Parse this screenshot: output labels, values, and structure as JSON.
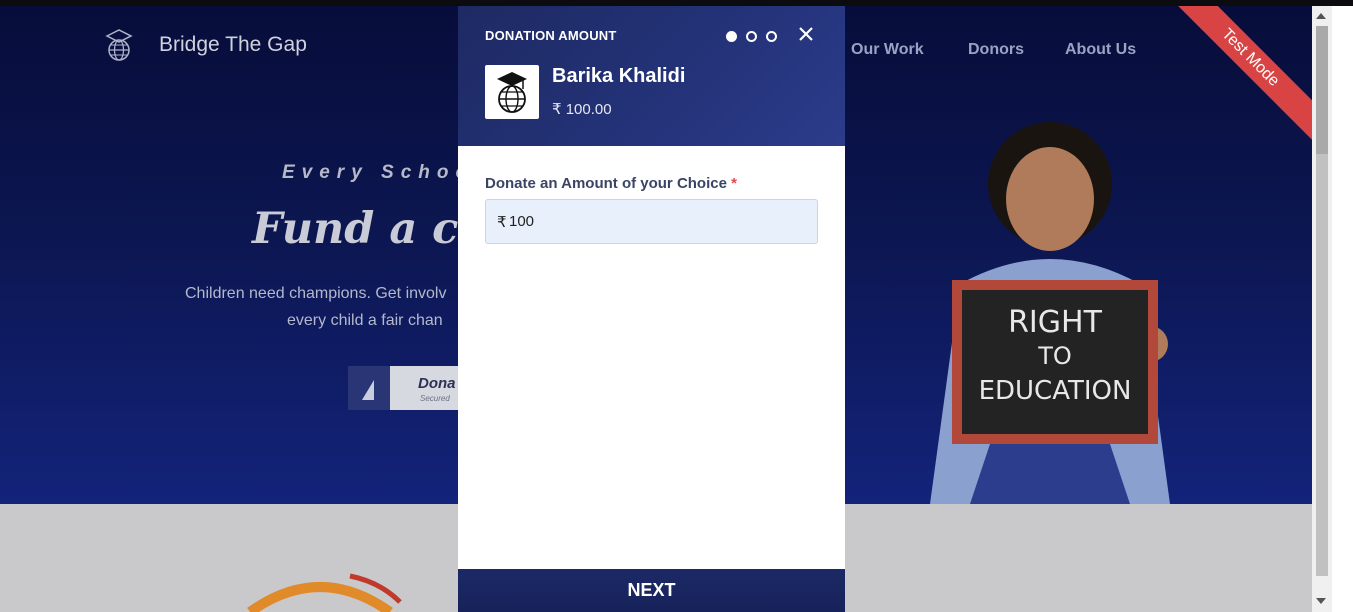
{
  "site": {
    "brand": "Bridge The Gap",
    "nav": [
      "Our Work",
      "Donors",
      "About Us"
    ],
    "hero": {
      "subtitle": "Every School",
      "title": "Fund a chil",
      "line1": "Children need champions. Get involv",
      "line2": "every child a fair chan",
      "donate_label": "Dona",
      "donate_secured": "Secured"
    },
    "ribbon": "Test Mode",
    "chalkboard": [
      "RIGHT",
      "TO",
      "EDUCATION"
    ]
  },
  "modal": {
    "title": "DONATION AMOUNT",
    "steps": 3,
    "active_step": 1,
    "close_icon": "close-icon",
    "org_name": "Barika Khalidi",
    "org_amount": "₹ 100.00",
    "field_label": "Donate an Amount of your Choice",
    "required_mark": "*",
    "currency": "₹",
    "amount_value": "100",
    "next_label": "NEXT"
  },
  "colors": {
    "modal_header": "#24337a",
    "input_bg": "#e8f0fc",
    "ribbon": "#d84444",
    "required": "#e04a4a"
  }
}
